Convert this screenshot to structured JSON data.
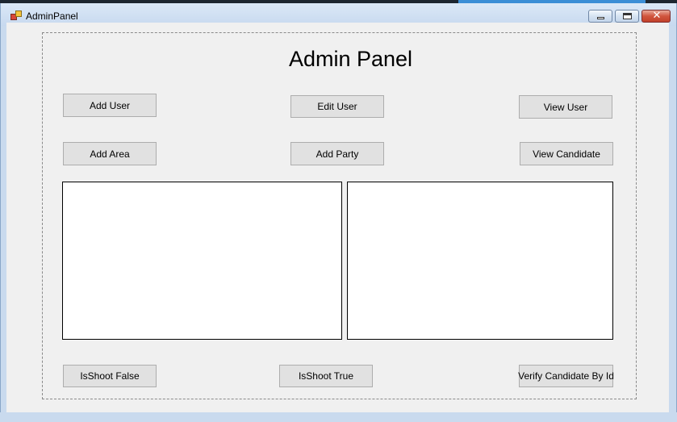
{
  "window": {
    "title": "AdminPanel",
    "controls": {
      "minimize": "minimize",
      "maximize": "maximize",
      "close": "✕"
    }
  },
  "main": {
    "heading": "Admin Panel",
    "buttons": {
      "add_user": "Add User",
      "edit_user": "Edit User",
      "view_user": "View User",
      "add_area": "Add Area",
      "add_party": "Add Party",
      "view_candidate": "View Candidate",
      "isshoot_false": "IsShoot False",
      "isshoot_true": "IsShoot True",
      "verify_candidate": "Verify Candidate By Id"
    }
  }
}
